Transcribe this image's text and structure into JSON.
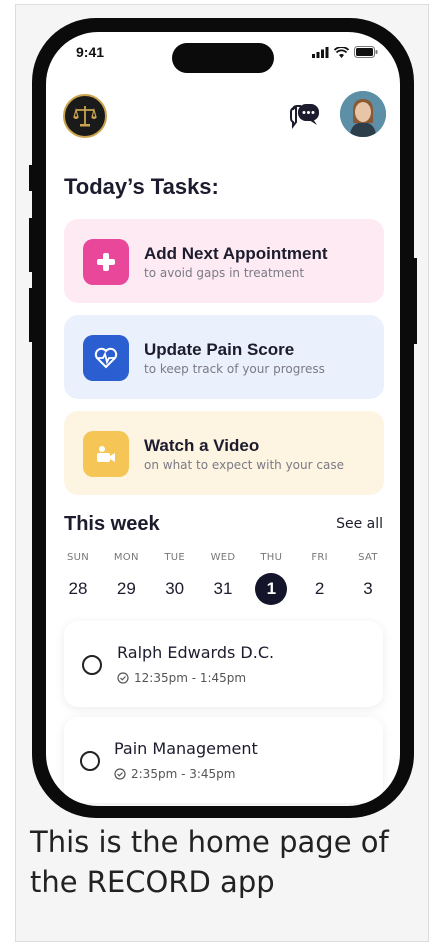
{
  "status_bar": {
    "time": "9:41"
  },
  "header": {
    "logo_icon": "scales-of-justice-icon",
    "chat_icon": "chat-bubbles-icon",
    "avatar_icon": "user-avatar"
  },
  "page_title": "Today’s Tasks:",
  "tasks": [
    {
      "title": "Add Next Appointment",
      "subtitle": "to avoid gaps in treatment",
      "icon": "plus-icon",
      "icon_color": "#e8479a",
      "bg_color": "#fdeaf2"
    },
    {
      "title": "Update Pain Score",
      "subtitle": "to keep track of your progress",
      "icon": "heartbeat-icon",
      "icon_color": "#2b5fd1",
      "bg_color": "#eaf0fc"
    },
    {
      "title": "Watch a Video",
      "subtitle": "on what to expect with your case",
      "icon": "video-camera-icon",
      "icon_color": "#f5c556",
      "bg_color": "#fdf4e2"
    }
  ],
  "week": {
    "title": "This week",
    "see_all": "See all",
    "days": [
      {
        "name": "SUN",
        "date": "28"
      },
      {
        "name": "MON",
        "date": "29"
      },
      {
        "name": "TUE",
        "date": "30"
      },
      {
        "name": "WED",
        "date": "31"
      },
      {
        "name": "THU",
        "date": "1",
        "selected": true
      },
      {
        "name": "FRI",
        "date": "2"
      },
      {
        "name": "SAT",
        "date": "3"
      }
    ]
  },
  "appointments": [
    {
      "name": "Ralph Edwards D.C.",
      "time": "12:35pm - 1:45pm"
    },
    {
      "name": "Pain Management",
      "time": "2:35pm - 3:45pm"
    }
  ],
  "caption": "This is the home page of the RECORD app"
}
